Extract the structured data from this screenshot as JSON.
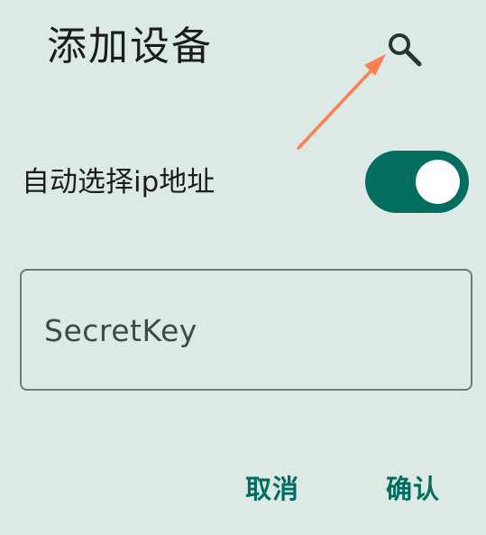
{
  "dialog": {
    "title": "添加设备",
    "search_icon": "search-icon",
    "auto_ip": {
      "label": "自动选择ip地址",
      "enabled": true
    },
    "secret_key": {
      "placeholder": "SecretKey",
      "value": ""
    },
    "actions": {
      "cancel_label": "取消",
      "confirm_label": "确认"
    }
  },
  "annotation": {
    "arrow_color": "#ff7f50"
  },
  "colors": {
    "background": "#dde9e5",
    "accent": "#006d5f",
    "text": "#1b1d1c",
    "outline": "#6f7976"
  }
}
